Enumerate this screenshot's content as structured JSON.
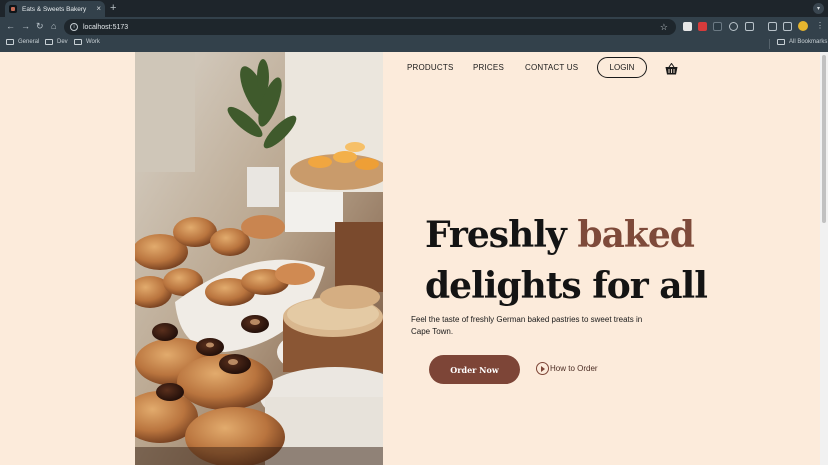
{
  "browser": {
    "tab_title": "Eats & Sweets Bakery",
    "tab_close": "×",
    "new_tab": "+",
    "menu_down": "▾",
    "url": "localhost:5173",
    "star": "☆",
    "kebab": "⋮",
    "nav": {
      "back": "←",
      "forward": "→",
      "reload": "↻",
      "home": "⌂"
    },
    "bookmarks": [
      {
        "label": "General"
      },
      {
        "label": "Dev"
      },
      {
        "label": "Work"
      }
    ],
    "all_bookmarks": "All Bookmarks",
    "icons": [
      "back-icon",
      "forward-icon",
      "reload-icon",
      "home-icon",
      "star-icon",
      "folder-icon",
      "profile-avatar"
    ]
  },
  "site": {
    "nav": {
      "products": "PRODUCTS",
      "prices": "PRICES",
      "contact": "CONTACT US",
      "login": "LOGIN"
    },
    "hero": {
      "headline_word1": "Freshly",
      "headline_accent": "baked",
      "headline_line2": "delights for all",
      "subtext": "Feel the taste of freshly German baked pastries to sweet treats in Cape Town.",
      "cta_primary": "Order Now",
      "cta_secondary": "How to Order"
    },
    "colors": {
      "background": "#fcebdb",
      "accent": "#7e4a3a",
      "button": "#7d4537",
      "text": "#141414"
    },
    "icons": [
      "cart-basket-icon",
      "play-circle-icon"
    ]
  }
}
